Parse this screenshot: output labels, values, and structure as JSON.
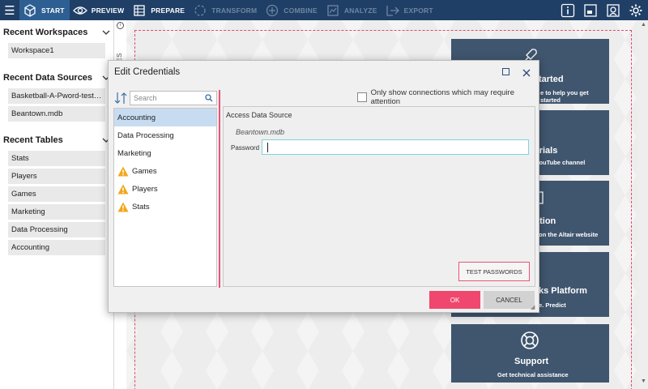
{
  "topbar": {
    "tabs": [
      {
        "label": "START",
        "icon": "cube-icon",
        "state": "active"
      },
      {
        "label": "PREVIEW",
        "icon": "eye-icon",
        "state": "enabled"
      },
      {
        "label": "PREPARE",
        "icon": "table-icon",
        "state": "enabled"
      },
      {
        "label": "TRANSFORM",
        "icon": "transform-icon",
        "state": "disabled"
      },
      {
        "label": "COMBINE",
        "icon": "combine-icon",
        "state": "disabled"
      },
      {
        "label": "ANALYZE",
        "icon": "analyze-icon",
        "state": "disabled"
      },
      {
        "label": "EXPORT",
        "icon": "export-icon",
        "state": "disabled"
      }
    ],
    "right_icons": [
      "info-icon",
      "window-icon",
      "help-icon",
      "gear-icon"
    ],
    "colors": {
      "bar": "#1f3f66",
      "active_tab": "#2e5f93"
    }
  },
  "sidebar": {
    "sections": [
      {
        "title": "Recent Workspaces",
        "items": [
          "Workspace1"
        ]
      },
      {
        "title": "Recent Data Sources",
        "items": [
          "Basketball-A-Pword-test.ac...",
          "Beantown.mdb"
        ]
      },
      {
        "title": "Recent Tables",
        "items": [
          "Stats",
          "Players",
          "Games",
          "Marketing",
          "Data Processing",
          "Accounting"
        ]
      }
    ]
  },
  "recent_strip": {
    "label": "NT FILES"
  },
  "cards": [
    {
      "title": "tarted",
      "subtitle": "e to help you get started"
    },
    {
      "title": "orials",
      "subtitle": "YouTube channel"
    },
    {
      "title": "ation",
      "subtitle": "l on the Altair website"
    },
    {
      "title": "ks Platform",
      "subtitle": "e. Predict"
    },
    {
      "title": "Support",
      "subtitle": "Get technical assistance"
    }
  ],
  "dialog": {
    "title": "Edit Credentials",
    "search_placeholder": "Search",
    "filter_label": "Only show connections which may require attention",
    "list": [
      {
        "label": "Accounting",
        "warning": false,
        "selected": true
      },
      {
        "label": "Data Processing",
        "warning": false,
        "selected": false
      },
      {
        "label": "Marketing",
        "warning": false,
        "selected": false
      },
      {
        "label": "Games",
        "warning": true,
        "selected": false
      },
      {
        "label": "Players",
        "warning": true,
        "selected": false
      },
      {
        "label": "Stats",
        "warning": true,
        "selected": false
      }
    ],
    "panel": {
      "title": "Access Data Source",
      "source": "Beantown.mdb",
      "password_label": "Password",
      "password_value": ""
    },
    "test_button": "TEST PASSWORDS",
    "ok_button": "OK",
    "cancel_button": "CANCEL",
    "colors": {
      "accent": "#f0476e",
      "selection": "#c8dcf1",
      "warning": "#f2a71b"
    }
  }
}
